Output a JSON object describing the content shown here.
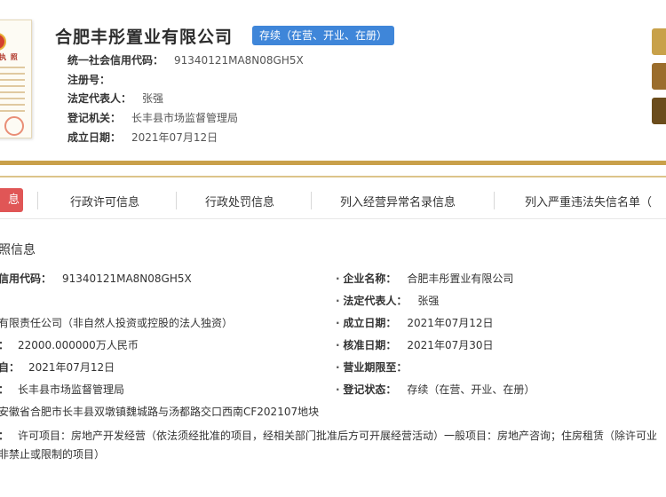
{
  "header": {
    "license_thumb_text": "执 照",
    "company_name": "合肥丰彤置业有限公司",
    "status_badge": "存续（在营、开业、在册）",
    "rows": [
      {
        "label": "统一社会信用代码：",
        "value": "91340121MA8N08GH5X"
      },
      {
        "label": "注册号：",
        "value": ""
      },
      {
        "label": "法定代表人：",
        "value": "张强"
      },
      {
        "label": "登记机关：",
        "value": "长丰县市场监督管理局"
      },
      {
        "label": "成立日期：",
        "value": "2021年07月12日"
      }
    ]
  },
  "colors": {
    "gold": "#c9a04a",
    "gold_light": "#dcc48a",
    "active_tab": "#e05656",
    "badge_blue": "#3f86d9",
    "side_btn_1": "#c8a14a",
    "side_btn_2": "#9b6d2c",
    "side_btn_3": "#6b4c1c"
  },
  "tabs": {
    "active": "息",
    "items": [
      "行政许可信息",
      "行政处罚信息",
      "列入经营异常名录信息",
      "列入严重违法失信名单（"
    ]
  },
  "details": {
    "section_title": "照信息",
    "credit_code_label": "信用代码：",
    "credit_code_value": "91340121MA8N08GH5X",
    "company_name_label": "企业名称：",
    "company_name_value": "合肥丰彤置业有限公司",
    "legal_rep_label": "法定代表人：",
    "legal_rep_value": "张强",
    "type_value": "有限责任公司（非自然人投资或控股的法人独资）",
    "established_label": "成立日期：",
    "established_value": "2021年07月12日",
    "capital_value": "22000.000000万人民币",
    "approval_label": "核准日期：",
    "approval_value": "2021年07月30日",
    "term_label": "自：",
    "term_value": "2021年07月12日",
    "term_end_label": "营业期限至：",
    "authority_value": "长丰县市场监督管理局",
    "reg_status_label": "登记状态：",
    "reg_status_value": "存续（在营、开业、在册）",
    "address_value": "安徽省合肥市长丰县双墩镇魏城路与汤都路交口西南CF202107地块",
    "scope_line1": "许可项目：房地产开发经营（依法须经批准的项目，经相关部门批准后方可开展经营活动）一般项目：房地产咨询；住房租赁（除许可业",
    "scope_line2": "非禁止或限制的项目）",
    "colon": "："
  }
}
